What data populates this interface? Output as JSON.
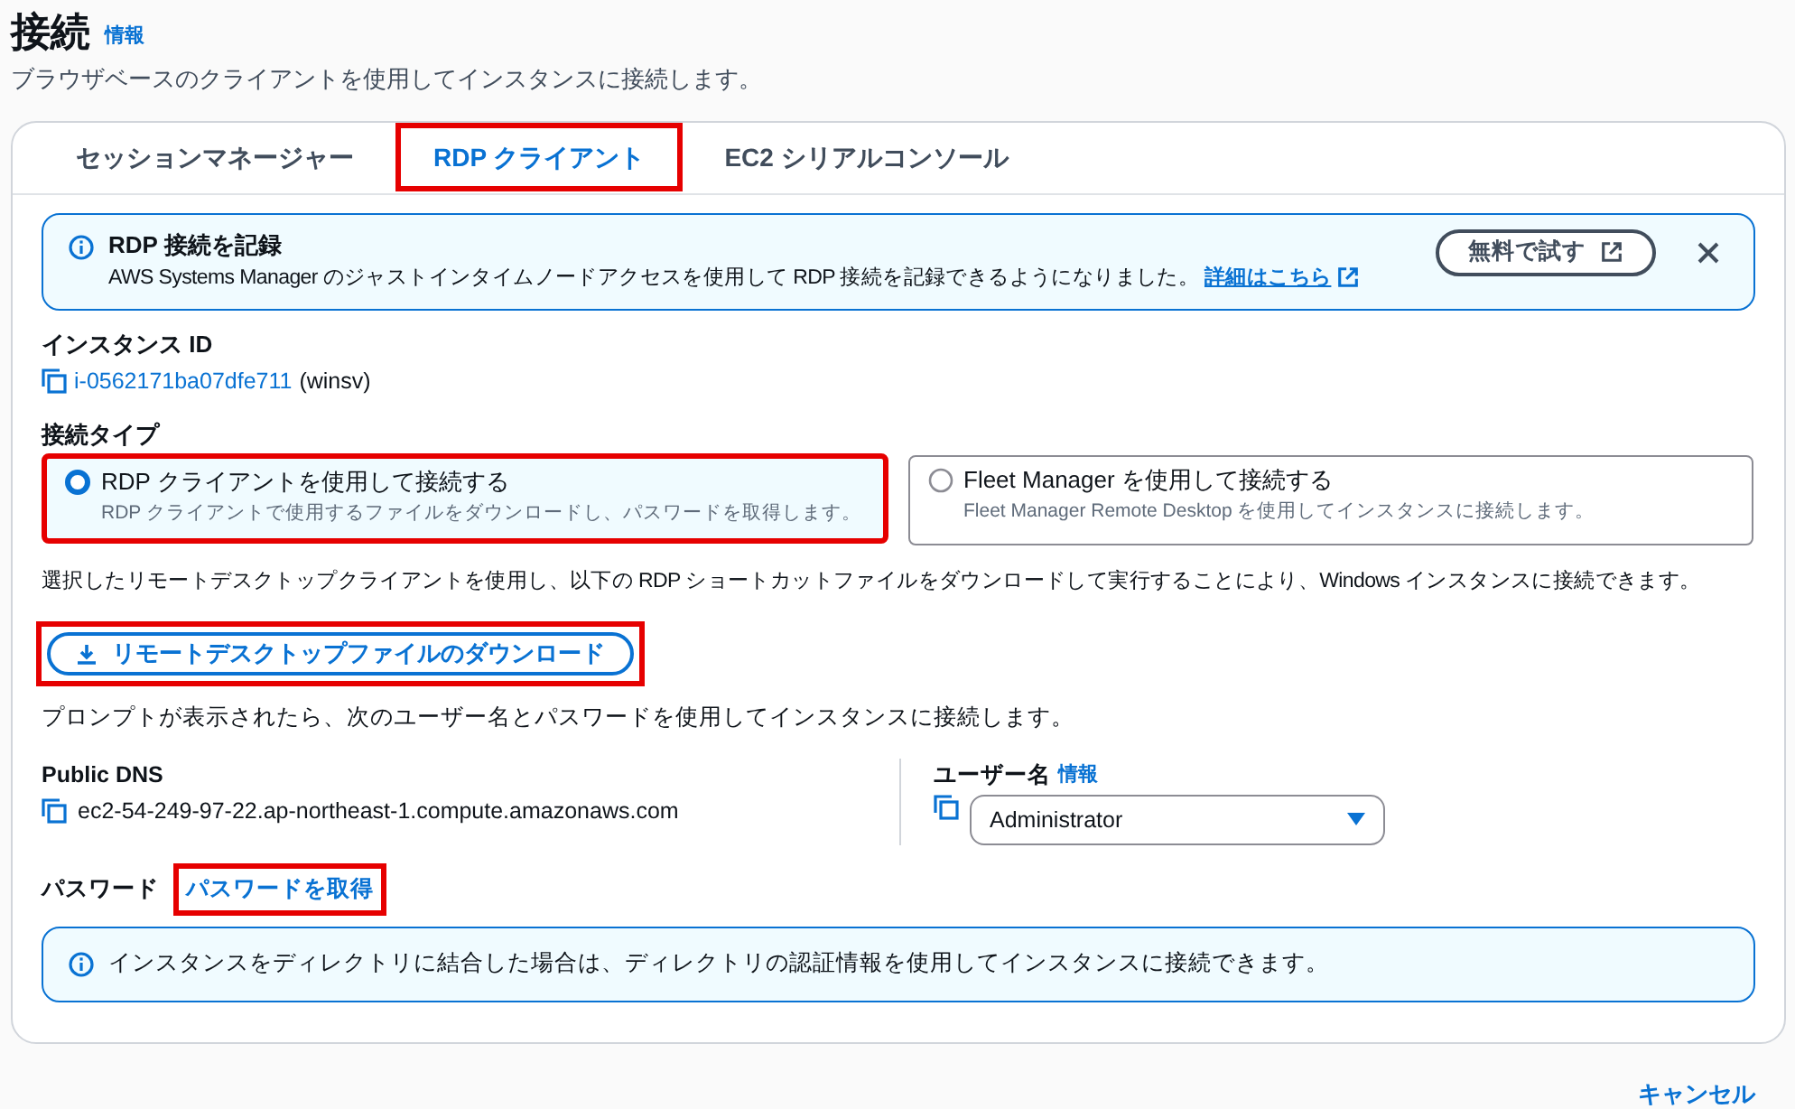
{
  "header": {
    "title": "接続",
    "info_link": "情報",
    "description": "ブラウザベースのクライアントを使用してインスタンスに接続します。"
  },
  "tabs": [
    {
      "label": "セッションマネージャー",
      "selected": false,
      "highlighted": false
    },
    {
      "label": "RDP クライアント",
      "selected": true,
      "highlighted": true
    },
    {
      "label": "EC2 シリアルコンソール",
      "selected": false,
      "highlighted": false
    }
  ],
  "notice": {
    "title": "RDP 接続を記録",
    "text": "AWS Systems Manager のジャストインタイムノードアクセスを使用して RDP 接続を記録できるようになりました。",
    "link": "詳細はこちら",
    "button": "無料で試す"
  },
  "instance_id": {
    "label": "インスタンス ID",
    "value": "i-0562171ba07dfe711",
    "suffix": "(winsv)"
  },
  "connection_type": {
    "label": "接続タイプ",
    "options": [
      {
        "title": "RDP クライアントを使用して接続する",
        "description": "RDP クライアントで使用するファイルをダウンロードし、パスワードを取得します。",
        "selected": true,
        "highlighted": true
      },
      {
        "title": "Fleet Manager を使用して接続する",
        "description": "Fleet Manager Remote Desktop を使用してインスタンスに接続します。",
        "selected": false,
        "highlighted": false
      }
    ]
  },
  "instructions": "選択したリモートデスクトップクライアントを使用し、以下の RDP ショートカットファイルをダウンロードして実行することにより、Windows インスタンスに接続できます。",
  "download_button": {
    "label": "リモートデスクトップファイルのダウンロード",
    "highlighted": true
  },
  "prompt_text": "プロンプトが表示されたら、次のユーザー名とパスワードを使用してインスタンスに接続します。",
  "public_dns": {
    "label": "Public DNS",
    "value": "ec2-54-249-97-22.ap-northeast-1.compute.amazonaws.com"
  },
  "username": {
    "label": "ユーザー名",
    "info_link": "情報",
    "value": "Administrator"
  },
  "password": {
    "label": "パスワード",
    "link": "パスワードを取得",
    "highlighted": true
  },
  "directory_notice": "インスタンスをディレクトリに結合した場合は、ディレクトリの認証情報を使用してインスタンスに接続できます。",
  "cancel_button": "キャンセル"
}
